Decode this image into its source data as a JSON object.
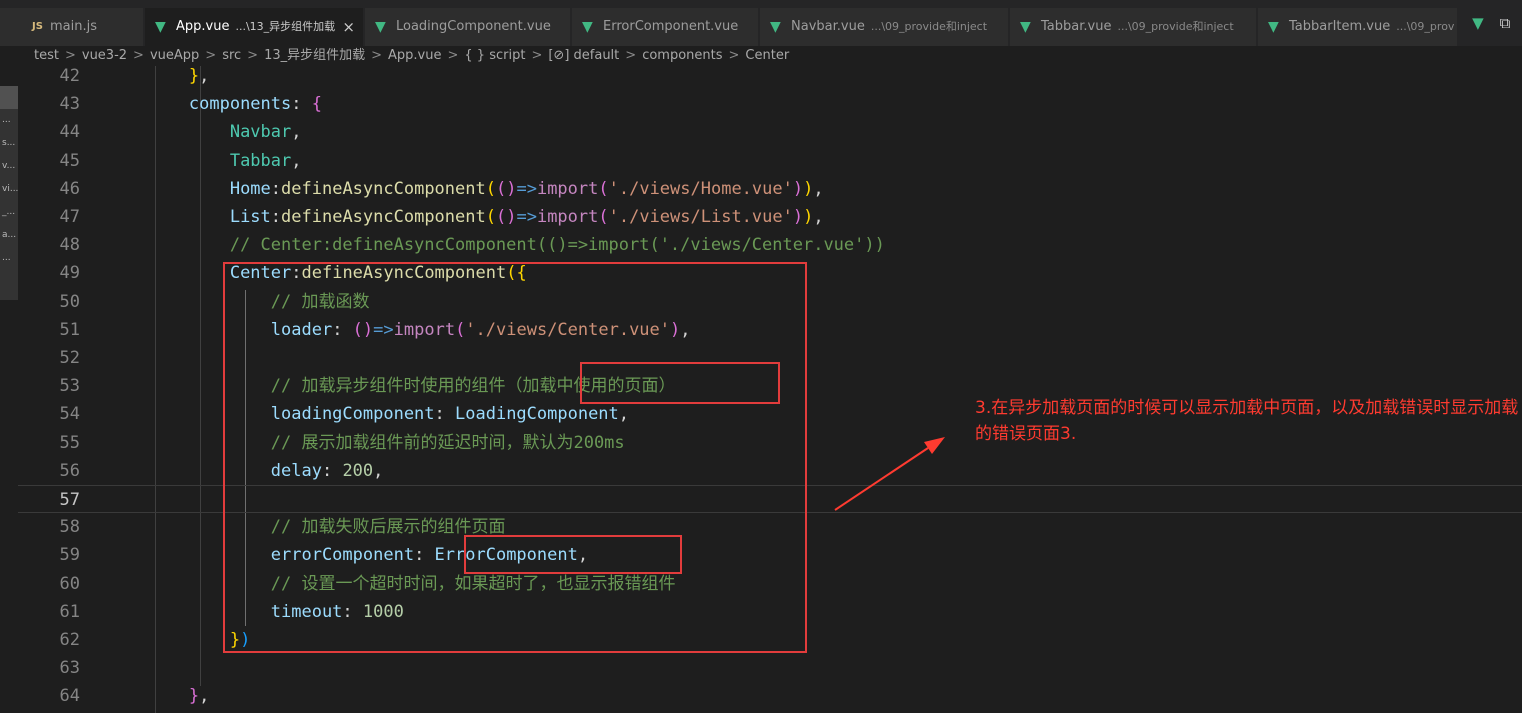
{
  "tabs": [
    {
      "label": "main.js",
      "icon": "js-file-icon",
      "desc": ""
    },
    {
      "label": "App.vue",
      "icon": "vue-file-icon",
      "desc": "...\\13_异步组件加载",
      "close": "×",
      "active": true
    },
    {
      "label": "LoadingComponent.vue",
      "icon": "vue-file-icon",
      "desc": ""
    },
    {
      "label": "ErrorComponent.vue",
      "icon": "vue-file-icon",
      "desc": ""
    },
    {
      "label": "Navbar.vue",
      "icon": "vue-file-icon",
      "desc": "...\\09_provide和inject"
    },
    {
      "label": "Tabbar.vue",
      "icon": "vue-file-icon",
      "desc": "...\\09_provide和inject"
    },
    {
      "label": "TabbarItem.vue",
      "icon": "vue-file-icon",
      "desc": "...\\09_prov"
    }
  ],
  "tab_icon_text": {
    "js": "JS",
    "vue": "▼"
  },
  "actions": {
    "run": "▷",
    "vue_devtools": "▼",
    "split": "⧉"
  },
  "breadcrumb": [
    "test",
    "vue3-2",
    "vueApp",
    "src",
    "13_异步组件加载",
    "App.vue",
    "{ } script",
    "[⊘] default",
    "components",
    "Center"
  ],
  "breadcrumb_sep": ">",
  "left_strip": [
    "",
    "...",
    "s...",
    "v...",
    "vi...",
    "_...",
    "a...",
    "..."
  ],
  "code_lines": [
    {
      "n": "42",
      "tokens": [
        [
          "        ",
          ""
        ],
        [
          "}",
          "t-brace2"
        ],
        [
          ",",
          "t-punc"
        ]
      ]
    },
    {
      "n": "43",
      "tokens": [
        [
          "        ",
          ""
        ],
        [
          "components",
          "t-prop"
        ],
        [
          ": ",
          "t-punc"
        ],
        [
          "{",
          "t-brace"
        ]
      ]
    },
    {
      "n": "44",
      "tokens": [
        [
          "            ",
          ""
        ],
        [
          "Navbar",
          "t-comp"
        ],
        [
          ",",
          "t-punc"
        ]
      ]
    },
    {
      "n": "45",
      "tokens": [
        [
          "            ",
          ""
        ],
        [
          "Tabbar",
          "t-comp"
        ],
        [
          ",",
          "t-punc"
        ]
      ]
    },
    {
      "n": "46",
      "tokens": [
        [
          "            ",
          ""
        ],
        [
          "Home",
          "t-prop"
        ],
        [
          ":",
          "t-punc"
        ],
        [
          "defineAsyncComponent",
          "t-func"
        ],
        [
          "(",
          "t-brace2"
        ],
        [
          "()",
          "t-paren"
        ],
        [
          "=>",
          "t-arrow"
        ],
        [
          "import",
          "t-import"
        ],
        [
          "(",
          "t-paren"
        ],
        [
          "'./views/Home.vue'",
          "t-str"
        ],
        [
          ")",
          "t-paren"
        ],
        [
          ")",
          "t-brace2"
        ],
        [
          ",",
          "t-punc"
        ]
      ]
    },
    {
      "n": "47",
      "tokens": [
        [
          "            ",
          ""
        ],
        [
          "List",
          "t-prop"
        ],
        [
          ":",
          "t-punc"
        ],
        [
          "defineAsyncComponent",
          "t-func"
        ],
        [
          "(",
          "t-brace2"
        ],
        [
          "()",
          "t-paren"
        ],
        [
          "=>",
          "t-arrow"
        ],
        [
          "import",
          "t-import"
        ],
        [
          "(",
          "t-paren"
        ],
        [
          "'./views/List.vue'",
          "t-str"
        ],
        [
          ")",
          "t-paren"
        ],
        [
          ")",
          "t-brace2"
        ],
        [
          ",",
          "t-punc"
        ]
      ]
    },
    {
      "n": "48",
      "tokens": [
        [
          "            ",
          ""
        ],
        [
          "// Center:defineAsyncComponent(()=>import('./views/Center.vue'))",
          "t-com"
        ]
      ]
    },
    {
      "n": "49",
      "tokens": [
        [
          "            ",
          ""
        ],
        [
          "Center",
          "t-prop"
        ],
        [
          ":",
          "t-punc"
        ],
        [
          "defineAsyncComponent",
          "t-func"
        ],
        [
          "(",
          "t-brace2"
        ],
        [
          "{",
          "t-brace2"
        ]
      ]
    },
    {
      "n": "50",
      "tokens": [
        [
          "                ",
          ""
        ],
        [
          "// 加载函数",
          "t-com"
        ]
      ]
    },
    {
      "n": "51",
      "tokens": [
        [
          "                ",
          ""
        ],
        [
          "loader",
          "t-prop"
        ],
        [
          ": ",
          "t-punc"
        ],
        [
          "()",
          "t-paren"
        ],
        [
          "=>",
          "t-arrow"
        ],
        [
          "import",
          "t-import"
        ],
        [
          "(",
          "t-paren"
        ],
        [
          "'./views/Center.vue'",
          "t-str"
        ],
        [
          ")",
          "t-paren"
        ],
        [
          ",",
          "t-punc"
        ]
      ]
    },
    {
      "n": "52",
      "tokens": []
    },
    {
      "n": "53",
      "tokens": [
        [
          "                ",
          ""
        ],
        [
          "// 加载异步组件时使用的组件（加载中使用的页面）",
          "t-com"
        ]
      ]
    },
    {
      "n": "54",
      "tokens": [
        [
          "                ",
          ""
        ],
        [
          "loadingComponent",
          "t-prop"
        ],
        [
          ": ",
          "t-punc"
        ],
        [
          "LoadingComponent",
          "t-var"
        ],
        [
          ",",
          "t-punc"
        ]
      ]
    },
    {
      "n": "55",
      "tokens": [
        [
          "                ",
          ""
        ],
        [
          "// 展示加载组件前的延迟时间，默认为200ms",
          "t-com"
        ]
      ]
    },
    {
      "n": "56",
      "tokens": [
        [
          "                ",
          ""
        ],
        [
          "delay",
          "t-prop"
        ],
        [
          ": ",
          "t-punc"
        ],
        [
          "200",
          "t-num"
        ],
        [
          ",",
          "t-punc"
        ]
      ]
    },
    {
      "n": "57",
      "tokens": [],
      "current": true
    },
    {
      "n": "58",
      "tokens": [
        [
          "                ",
          ""
        ],
        [
          "// 加载失败后展示的组件页面",
          "t-com"
        ]
      ]
    },
    {
      "n": "59",
      "tokens": [
        [
          "                ",
          ""
        ],
        [
          "errorComponent",
          "t-prop"
        ],
        [
          ": ",
          "t-punc"
        ],
        [
          "ErrorComponent",
          "t-var"
        ],
        [
          ",",
          "t-punc"
        ]
      ]
    },
    {
      "n": "60",
      "tokens": [
        [
          "                ",
          ""
        ],
        [
          "// 设置一个超时时间，如果超时了，也显示报错组件",
          "t-com"
        ]
      ]
    },
    {
      "n": "61",
      "tokens": [
        [
          "                ",
          ""
        ],
        [
          "timeout",
          "t-prop"
        ],
        [
          ": ",
          "t-punc"
        ],
        [
          "1000",
          "t-num"
        ]
      ]
    },
    {
      "n": "62",
      "tokens": [
        [
          "            ",
          ""
        ],
        [
          "}",
          "t-brace2"
        ],
        [
          ")",
          "t-paren2"
        ]
      ]
    },
    {
      "n": "63",
      "tokens": []
    },
    {
      "n": "64",
      "tokens": [
        [
          "        ",
          ""
        ],
        [
          "}",
          "t-brace"
        ],
        [
          ",",
          "t-punc"
        ]
      ]
    }
  ],
  "annotation": "3.在异步加载页面的时候可以显示加载中页面，以及加载错误时显示加载的错误页面3.",
  "colors": {
    "annotation_red": "#e23c3c",
    "editor_bg": "#1e1e1e"
  }
}
